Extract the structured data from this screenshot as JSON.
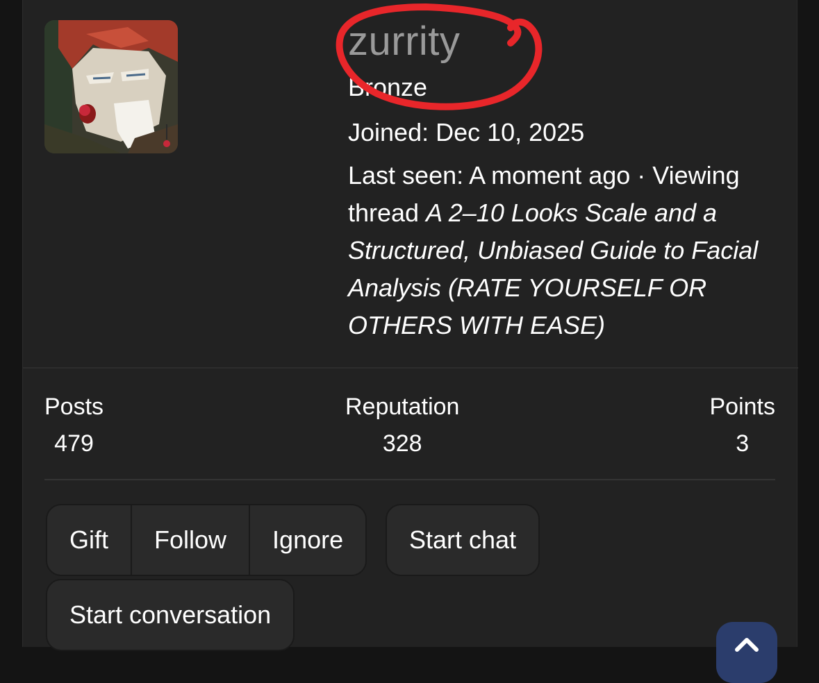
{
  "profile": {
    "username": "zurrity",
    "rank": "Bronze",
    "joined": "Joined: Dec 10, 2025",
    "last_seen_prefix": "Last seen: A moment ago · Viewing thread ",
    "last_seen_thread": "A 2–10 Looks Scale and a Structured, Unbiased Guide to Facial Analysis (RATE YOURSELF OR OTHERS WITH EASE)"
  },
  "stats": [
    {
      "label": "Posts",
      "value": "479"
    },
    {
      "label": "Reputation",
      "value": "328"
    },
    {
      "label": "Points",
      "value": "3"
    }
  ],
  "actions": {
    "gift": "Gift",
    "follow": "Follow",
    "ignore": "Ignore",
    "start_chat": "Start chat",
    "start_conversation": "Start conversation"
  },
  "icons": {
    "avatar": "avatar-image",
    "scroll_top": "chevron-up-icon",
    "annotation": "red-circle-annotation"
  },
  "colors": {
    "background": "#222222",
    "username": "#9a9a9a",
    "annotation": "#e8262a",
    "fab": "#2b3d6c"
  }
}
